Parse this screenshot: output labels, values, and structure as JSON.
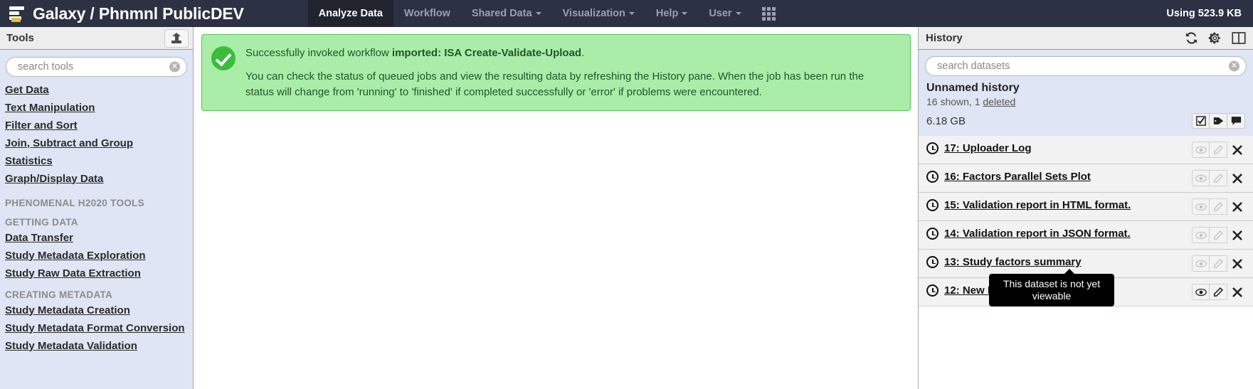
{
  "masthead": {
    "brand_title": "Galaxy / Phnmnl PublicDEV",
    "logo_icon": "galaxy-bars-logo",
    "nav": [
      {
        "label": "Analyze Data",
        "active": true,
        "caret": false
      },
      {
        "label": "Workflow",
        "active": false,
        "caret": false
      },
      {
        "label": "Shared Data",
        "active": false,
        "caret": true
      },
      {
        "label": "Visualization",
        "active": false,
        "caret": true
      },
      {
        "label": "Help",
        "active": false,
        "caret": true
      },
      {
        "label": "User",
        "active": false,
        "caret": true
      }
    ],
    "grid_icon": "apps-grid-icon",
    "usage": "Using 523.9 KB"
  },
  "tools": {
    "header_title": "Tools",
    "upload_icon": "upload-icon",
    "search": {
      "placeholder": "search tools",
      "value": "",
      "clear_icon": "clear-circle-icon"
    },
    "items": [
      {
        "type": "link",
        "label": "Get Data"
      },
      {
        "type": "link",
        "label": "Text Manipulation"
      },
      {
        "type": "link",
        "label": "Filter and Sort"
      },
      {
        "type": "link",
        "label": "Join, Subtract and Group"
      },
      {
        "type": "link",
        "label": "Statistics"
      },
      {
        "type": "link",
        "label": "Graph/Display Data"
      },
      {
        "type": "section",
        "label": "PHENOMENAL H2020 TOOLS"
      },
      {
        "type": "section",
        "label": "GETTING DATA"
      },
      {
        "type": "link",
        "label": "Data Transfer"
      },
      {
        "type": "link",
        "label": "Study Metadata Exploration"
      },
      {
        "type": "link",
        "label": "Study Raw Data Extraction"
      },
      {
        "type": "section",
        "label": "CREATING METADATA"
      },
      {
        "type": "link",
        "label": "Study Metadata Creation"
      },
      {
        "type": "link",
        "label": "Study Metadata Format Conversion"
      },
      {
        "type": "link",
        "label": "Study Metadata Validation"
      }
    ]
  },
  "center": {
    "alert": {
      "icon": "success-check-icon",
      "line1_prefix": "Successfully invoked workflow ",
      "line1_workflow": "imported: ISA Create-Validate-Upload",
      "line1_suffix": ".",
      "line2": "You can check the status of queued jobs and view the resulting data by refreshing the History pane. When the job has been run the status will change from 'running' to 'finished' if completed successfully or 'error' if problems were encountered."
    }
  },
  "history": {
    "header_title": "History",
    "header_icons": [
      {
        "name": "refresh-icon"
      },
      {
        "name": "gear-icon"
      },
      {
        "name": "columns-icon"
      }
    ],
    "search": {
      "placeholder": "search datasets",
      "value": "",
      "clear_icon": "clear-circle-icon"
    },
    "name": "Unnamed history",
    "shown_text": "16 shown, 1 ",
    "deleted_link": "deleted",
    "size": "6.18 GB",
    "action_icons": [
      {
        "name": "select-checkbox-icon"
      },
      {
        "name": "tag-icon"
      },
      {
        "name": "annotation-icon"
      }
    ],
    "datasets": [
      {
        "title": "17: Uploader Log ",
        "state_icon": "clock-icon",
        "viewable": false
      },
      {
        "title": "16: Factors Parallel Sets Plot ",
        "state_icon": "clock-icon",
        "viewable": false
      },
      {
        "title": "15: Validation report in HTML format. ",
        "state_icon": "clock-icon",
        "viewable": false
      },
      {
        "title": "14: Validation report in JSON format. ",
        "state_icon": "clock-icon",
        "viewable": false
      },
      {
        "title": "13: Study factors summary ",
        "state_icon": "clock-icon",
        "viewable": false
      },
      {
        "title": "12: New ISA-Tab ",
        "state_icon": "clock-icon",
        "viewable": true
      }
    ],
    "dataset_buttons": {
      "view_icon": "eye-icon",
      "edit_icon": "pencil-icon",
      "delete_icon": "close-x-icon"
    },
    "tooltip": "This dataset is not yet viewable"
  },
  "colors": {
    "masthead_bg": "#2c3143",
    "masthead_active_bg": "#21242f",
    "panel_bg": "#dfe5f4",
    "alert_bg": "#a9eda9",
    "alert_border": "#5cbf5c",
    "accent_yellow": "#e5c13a"
  }
}
